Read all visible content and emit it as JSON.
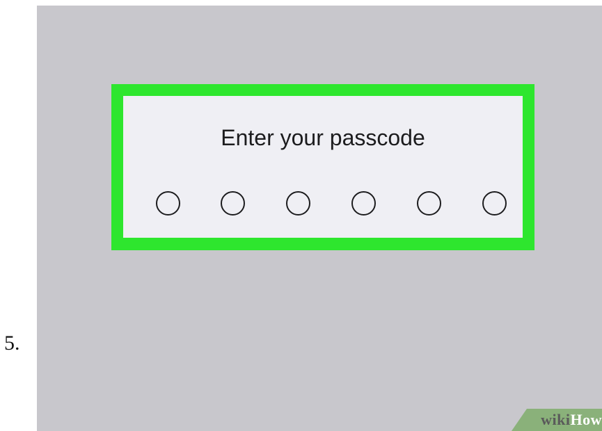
{
  "step": {
    "number": "5."
  },
  "screen": {
    "background_color": "#c8c7cc",
    "highlight_color": "#2ee62e",
    "passcode_prompt": "Enter your passcode",
    "passcode_length": 6,
    "digits_entered": 0
  },
  "watermark": {
    "brand_wiki": "wiki",
    "brand_how": "How",
    "band_color": "#8ab17a"
  }
}
